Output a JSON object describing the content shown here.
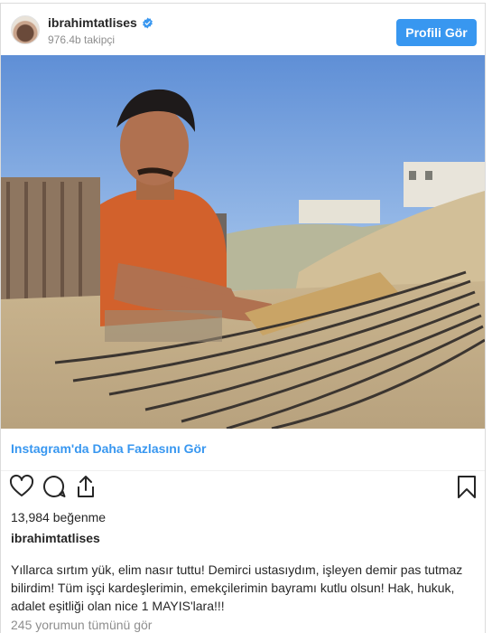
{
  "header": {
    "username": "ibrahimtatlises",
    "followers": "976.4b takipçi",
    "profile_button": "Profili Gör"
  },
  "media_footer": {
    "more_link": "Instagram'da Daha Fazlasını Gör"
  },
  "stats": {
    "likes": "13,984 beğenme"
  },
  "post": {
    "author": "ibrahimtatlises",
    "caption": "Yıllarca sırtım yük, elim nasır tuttu! Demirci ustasıydım, işleyen demir pas tutmaz bilirdim! Tüm işçi kardeşlerimin, emekçilerimin bayramı kutlu olsun! Hak, hukuk, adalet eşitliği olan nice 1 MAYIS'lara!!!",
    "comments_link": "245 yorumun tümünü gör"
  },
  "icons": {
    "verified": "verified-badge-icon",
    "like": "heart-icon",
    "comment": "comment-bubble-icon",
    "share": "share-icon",
    "save": "bookmark-icon"
  },
  "colors": {
    "accent": "#3897f0",
    "text": "#262626",
    "muted": "#8e8e8e",
    "border": "#dbdbdb"
  }
}
